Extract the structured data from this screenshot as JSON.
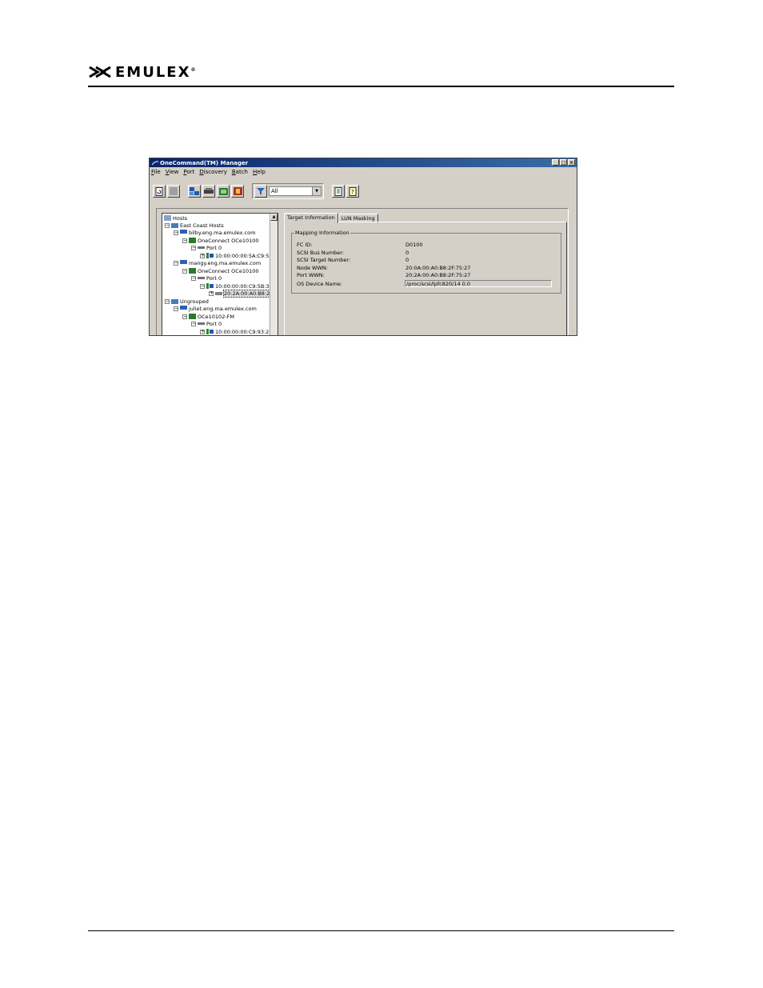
{
  "brand": {
    "name": "EMULEX",
    "trademark": "®"
  },
  "window": {
    "title": "OneCommand(TM) Manager",
    "controls": {
      "minimize": "_",
      "maximize": "□",
      "close": "×"
    },
    "menu": [
      "File",
      "View",
      "Port",
      "Discovery",
      "Batch",
      "Help"
    ],
    "toolbar": {
      "filter_value": "All",
      "icons": [
        "refresh-icon",
        "blank-icon",
        "host-view-icon",
        "fabric-view-icon",
        "adapter-view-icon",
        "discovery-icon",
        "filter-icon",
        "export-icon",
        "help-icon"
      ]
    },
    "tree": [
      {
        "label": "Hosts",
        "icon": "hosts-icon"
      },
      {
        "label": "East Coast Hosts",
        "icon": "group-icon"
      },
      {
        "label": "bilby.eng.ma.emulex.com",
        "icon": "host-icon"
      },
      {
        "label": "OneConnect OCe10100",
        "icon": "adapter-icon"
      },
      {
        "label": "Port 0",
        "icon": "port-icon"
      },
      {
        "label": "10:00:00:00:5A:C9:58:3",
        "icon": "target-icon"
      },
      {
        "label": "mangy.eng.ma.emulex.com",
        "icon": "host-icon"
      },
      {
        "label": "OneConnect OCe10100",
        "icon": "adapter-icon"
      },
      {
        "label": "Port 0",
        "icon": "port-icon"
      },
      {
        "label": "10:00:00:00:C9:5B:30",
        "icon": "target-icon"
      },
      {
        "label": "20:2A:00:A0:B8:2",
        "icon": "lun-icon"
      },
      {
        "label": "Ungrouped",
        "icon": "group-icon"
      },
      {
        "label": "juliet.eng.ma.emulex.com",
        "icon": "host-icon"
      },
      {
        "label": "OCe10102-FM",
        "icon": "adapter-icon"
      },
      {
        "label": "Port 0",
        "icon": "port-icon"
      },
      {
        "label": "10:00:00:00:C9:93:25",
        "icon": "target-icon"
      }
    ],
    "tabs": [
      "Target Information",
      "LUN Masking"
    ],
    "mapping": {
      "title": "Mapping Information",
      "fields": [
        {
          "label": "FC ID:",
          "value": "D0100"
        },
        {
          "label": "SCSI Bus Number:",
          "value": "0"
        },
        {
          "label": "SCSI Target Number:",
          "value": "0"
        },
        {
          "label": "Node WWN:",
          "value": "20:0A:00:A0:B8:2F:75:27"
        },
        {
          "label": "Port WWN:",
          "value": "20:2A:00:A0:B8:2F:75:27"
        },
        {
          "label": "OS Device Name:",
          "value": "/proc/scsi/lpfc820/14 0.0"
        }
      ]
    }
  }
}
